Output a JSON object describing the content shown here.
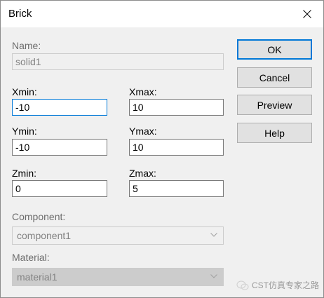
{
  "window": {
    "title": "Brick"
  },
  "name": {
    "label": "Name:",
    "value": "solid1"
  },
  "xmin": {
    "label": "Xmin:",
    "value": "-10"
  },
  "xmax": {
    "label": "Xmax:",
    "value": "10"
  },
  "ymin": {
    "label": "Ymin:",
    "value": "-10"
  },
  "ymax": {
    "label": "Ymax:",
    "value": "10"
  },
  "zmin": {
    "label": "Zmin:",
    "value": "0"
  },
  "zmax": {
    "label": "Zmax:",
    "value": "5"
  },
  "component": {
    "label": "Component:",
    "value": "component1"
  },
  "material": {
    "label": "Material:",
    "value": "material1"
  },
  "buttons": {
    "ok": "OK",
    "cancel": "Cancel",
    "preview": "Preview",
    "help": "Help"
  },
  "watermark": {
    "text": "CST仿真专家之路"
  },
  "colors": {
    "focus": "#0078d7",
    "button_face": "#e1e1e1",
    "dialog_bg": "#f0f0f0"
  }
}
